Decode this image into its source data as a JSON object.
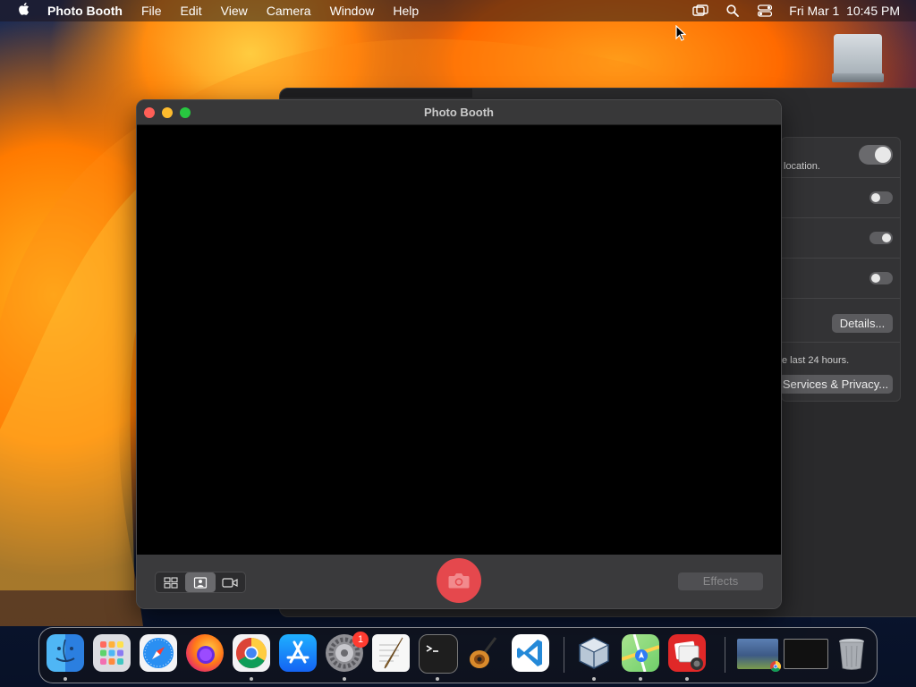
{
  "menubar": {
    "app_name": "Photo Booth",
    "menus": [
      "File",
      "Edit",
      "View",
      "Camera",
      "Window",
      "Help"
    ],
    "clock": "Fri Mar 1  10:45 PM"
  },
  "photobooth": {
    "title": "Photo Booth",
    "effects_label": "Effects"
  },
  "settings": {
    "location_note": "location.",
    "details_label": "Details...",
    "last24_note": "e last 24 hours.",
    "services_label": "Services & Privacy..."
  },
  "dock": {
    "items": [
      {
        "name": "Finder",
        "icon": "finder-icon"
      },
      {
        "name": "Launchpad",
        "icon": "launchpad-icon"
      },
      {
        "name": "Safari",
        "icon": "safari-icon"
      },
      {
        "name": "Firefox",
        "icon": "firefox-icon"
      },
      {
        "name": "Chrome",
        "icon": "chrome-icon"
      },
      {
        "name": "App Store",
        "icon": "app-store-icon"
      },
      {
        "name": "System Settings",
        "icon": "gear-icon",
        "badge": "1"
      },
      {
        "name": "TextEdit",
        "icon": "textedit-icon"
      },
      {
        "name": "Terminal",
        "icon": "terminal-icon"
      },
      {
        "name": "GarageBand",
        "icon": "guitar-icon"
      },
      {
        "name": "VS Code",
        "icon": "vscode-icon"
      },
      {
        "name": "VirtualBox",
        "icon": "virtualbox-icon"
      },
      {
        "name": "Maps",
        "icon": "maps-icon"
      },
      {
        "name": "Photo Booth",
        "icon": "photobooth-icon"
      }
    ]
  },
  "colors": {
    "shutter": "#e5484d",
    "accent_red": "#ff5f57",
    "accent_yellow": "#febc2e",
    "accent_green": "#28c840"
  }
}
